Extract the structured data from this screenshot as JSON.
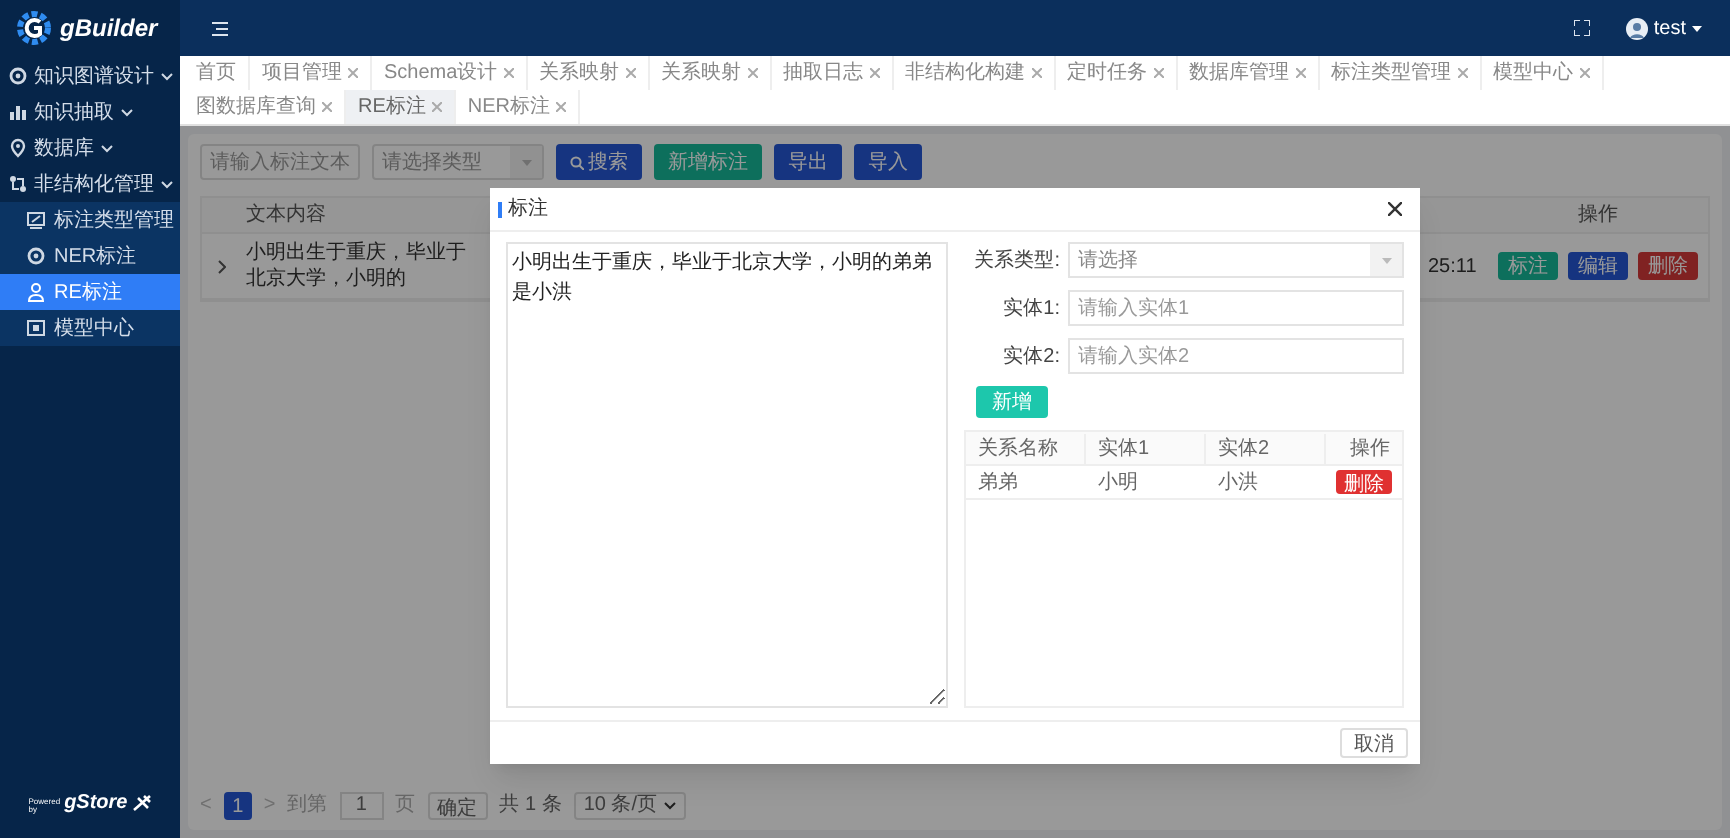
{
  "sidebar": {
    "logo": "gBuilder",
    "menu": [
      {
        "label": "知识图谱设计"
      },
      {
        "label": "知识抽取"
      },
      {
        "label": "数据库"
      },
      {
        "label": "非结构化管理",
        "children": [
          {
            "label": "标注类型管理",
            "selected": false
          },
          {
            "label": "NER标注",
            "selected": false
          },
          {
            "label": "RE标注",
            "selected": true
          },
          {
            "label": "模型中心",
            "selected": false
          }
        ]
      }
    ],
    "footer": {
      "powered": "Powered",
      "by": "by",
      "brand": "gStore"
    }
  },
  "header": {
    "user": "test"
  },
  "tabs": [
    {
      "label": "首页",
      "closable": false,
      "selected": false
    },
    {
      "label": "项目管理",
      "closable": true,
      "selected": false
    },
    {
      "label": "Schema设计",
      "closable": true,
      "selected": false
    },
    {
      "label": "关系映射",
      "closable": true,
      "selected": false
    },
    {
      "label": "关系映射",
      "closable": true,
      "selected": false
    },
    {
      "label": "抽取日志",
      "closable": true,
      "selected": false
    },
    {
      "label": "非结构化构建",
      "closable": true,
      "selected": false
    },
    {
      "label": "定时任务",
      "closable": true,
      "selected": false
    },
    {
      "label": "数据库管理",
      "closable": true,
      "selected": false
    },
    {
      "label": "标注类型管理",
      "closable": true,
      "selected": false
    },
    {
      "label": "模型中心",
      "closable": true,
      "selected": false
    },
    {
      "label": "图数据库查询",
      "closable": true,
      "selected": false
    },
    {
      "label": "RE标注",
      "closable": true,
      "selected": true
    },
    {
      "label": "NER标注",
      "closable": true,
      "selected": false
    }
  ],
  "filter": {
    "text_placeholder": "请输入标注文本",
    "type_placeholder": "请选择类型",
    "buttons": [
      {
        "label": "搜索",
        "kind": "search"
      },
      {
        "label": "新增标注",
        "kind": "add"
      },
      {
        "label": "导出",
        "kind": "plain"
      },
      {
        "label": "导入",
        "kind": "plain"
      }
    ]
  },
  "table": {
    "columns": [
      "文本内容",
      "操作"
    ],
    "rows": [
      {
        "text": "小明出生于重庆，毕业于北京大学，小明的",
        "time": "25:11",
        "actions": [
          {
            "label": "标注",
            "kind": "label"
          },
          {
            "label": "编辑",
            "kind": "edit"
          },
          {
            "label": "删除",
            "kind": "delete"
          }
        ]
      }
    ]
  },
  "pagination": {
    "prev": "<",
    "page": "1",
    "next": ">",
    "goto": "到第",
    "goto_value": "1",
    "page_unit": "页",
    "confirm": "确定",
    "total": "共 1 条",
    "page_size": "10 条/页"
  },
  "dialog": {
    "title": "标注",
    "text": "小明出生于重庆，毕业于北京大学，小明的弟弟是小洪",
    "fields": [
      {
        "label": "关系类型:",
        "placeholder": "请选择",
        "kind": "select"
      },
      {
        "label": "实体1:",
        "placeholder": "请输入实体1",
        "kind": "input"
      },
      {
        "label": "实体2:",
        "placeholder": "请输入实体2",
        "kind": "input"
      }
    ],
    "add_button": "新增",
    "relations": {
      "columns": [
        "关系名称",
        "实体1",
        "实体2",
        "操作"
      ],
      "rows": [
        {
          "cells": [
            "弟弟",
            "小明",
            "小洪"
          ],
          "action": "删除"
        }
      ]
    },
    "cancel": "取消"
  }
}
